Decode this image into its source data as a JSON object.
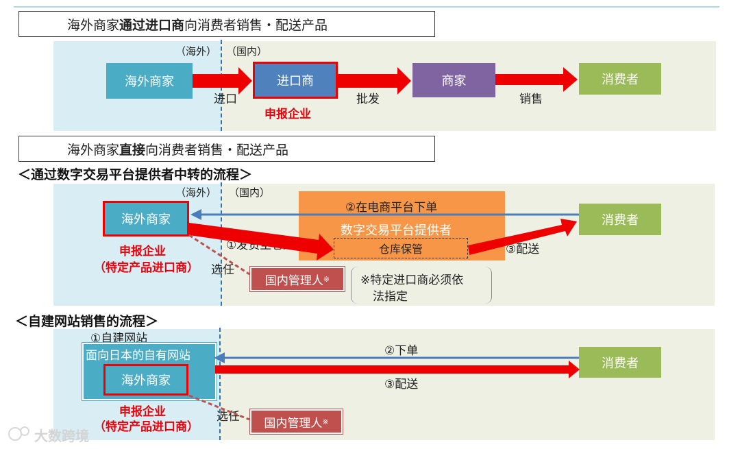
{
  "section1": {
    "title_pre": "海外商家",
    "title_bold": "通过进口商",
    "title_post": "向消费者销售・配送产品",
    "overseas_label": "（海外）",
    "domestic_label": "（国内）",
    "overseas_merchant": "海外商家",
    "importer": "进口商",
    "merchant": "商家",
    "consumer": "消费者",
    "import_label": "进口",
    "wholesale_label": "批发",
    "sales_label": "销售",
    "declarant": "申报企业"
  },
  "section2": {
    "title_pre": "海外商家",
    "title_bold": "直接",
    "title_post": "向消费者销售・配送产品",
    "subheading": "＜通过数字交易平台提供者中转的流程＞",
    "overseas_label": "（海外）",
    "domestic_label": "（国内）",
    "overseas_merchant": "海外商家",
    "declarant_line1": "申报企业",
    "declarant_line2": "（特定产品进口商）",
    "order_label": "②在电商平台下单",
    "platform": "数字交易平台提供者",
    "warehouse": "仓库保管",
    "ship_label": "①发货至仓库",
    "deliver_label": "③配送",
    "consumer": "消费者",
    "appoint_label": "选任",
    "manager": "国内管理人",
    "manager_mark": "※",
    "note_line1": "※特定进口商必须依",
    "note_line2": "法指定"
  },
  "section3": {
    "subheading": "＜自建网站销售的流程＞",
    "own_site_label": "①自建网站",
    "japan_site": "面向日本的自有网站",
    "overseas_merchant": "海外商家",
    "declarant_line1": "申报企业",
    "declarant_line2": "（特定产品进口商）",
    "order_label": "②下单",
    "deliver_label": "③配送",
    "consumer": "消费者",
    "appoint_label": "选任",
    "manager": "国内管理人",
    "manager_mark": "※"
  },
  "watermark": "大数跨境",
  "colors": {
    "arrow_red": "#ee0000",
    "arrow_blue": "#4a7ebb",
    "teal": "#4aacc5",
    "green": "#9bbb59",
    "purple": "#8064a2",
    "orange": "#f79646",
    "manager_red": "#c0504d"
  }
}
